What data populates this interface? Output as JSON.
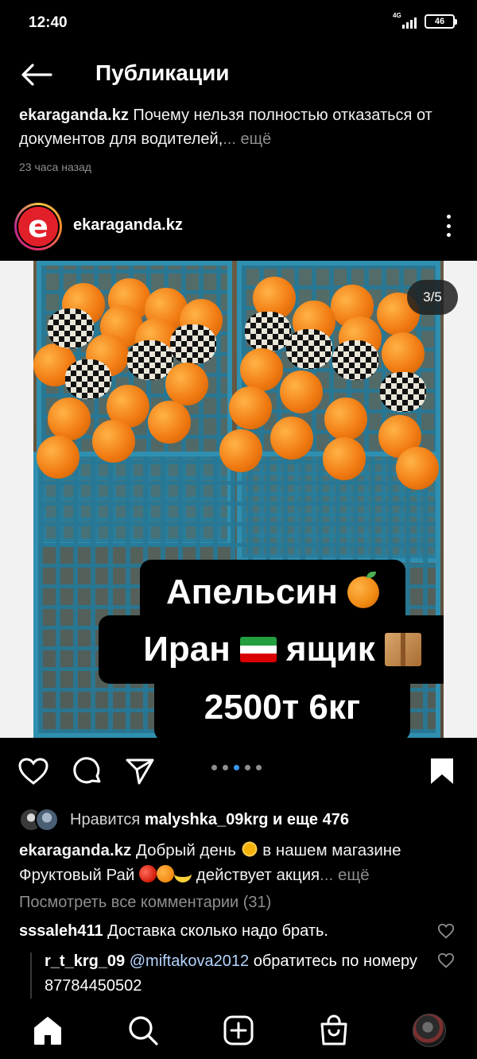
{
  "status_bar": {
    "time": "12:40",
    "network": "4G",
    "battery": "46"
  },
  "header": {
    "title": "Публикации"
  },
  "previous_post": {
    "username": "ekaraganda.kz",
    "caption": " Почему нельзя полностью отказаться от документов для водителей,",
    "more": "... ещё",
    "time": "23 часа назад"
  },
  "post": {
    "username": "ekaraganda.kz",
    "avatar_letter": "e",
    "slide_counter": "3/5",
    "image_text": {
      "line1": "Апельсин",
      "line2_a": "Иран",
      "line2_b": "ящик",
      "line3": "2500т 6кг"
    },
    "likes": {
      "prefix": "Нравится ",
      "user": "malyshka_09krg",
      "suffix": " и еще 476"
    },
    "caption": {
      "username": "ekaraganda.kz",
      "part1": " Добрый день ",
      "part2": "  в нашем магазине Фруктовый Рай ",
      "part3": " действует акция",
      "more": "... ещё"
    },
    "view_comments": "Посмотреть все комментарии (31)",
    "comments": [
      {
        "username": "sssaleh411",
        "text": " Доставка сколько надо брать."
      }
    ],
    "replies": [
      {
        "username": "r_t_krg_09",
        "mention": "@miftakova2012",
        "text": " обратитесь по номеру 87784450502"
      }
    ]
  },
  "colors": {
    "accent": "#3897f0",
    "crate": "#2f8fb0",
    "orange": "#f27c12",
    "muted": "#8e8e8e"
  },
  "icons": [
    "back-arrow-icon",
    "more-vertical-icon",
    "heart-icon",
    "comment-icon",
    "share-icon",
    "bookmark-icon",
    "home-icon",
    "search-icon",
    "create-icon",
    "shop-icon"
  ]
}
